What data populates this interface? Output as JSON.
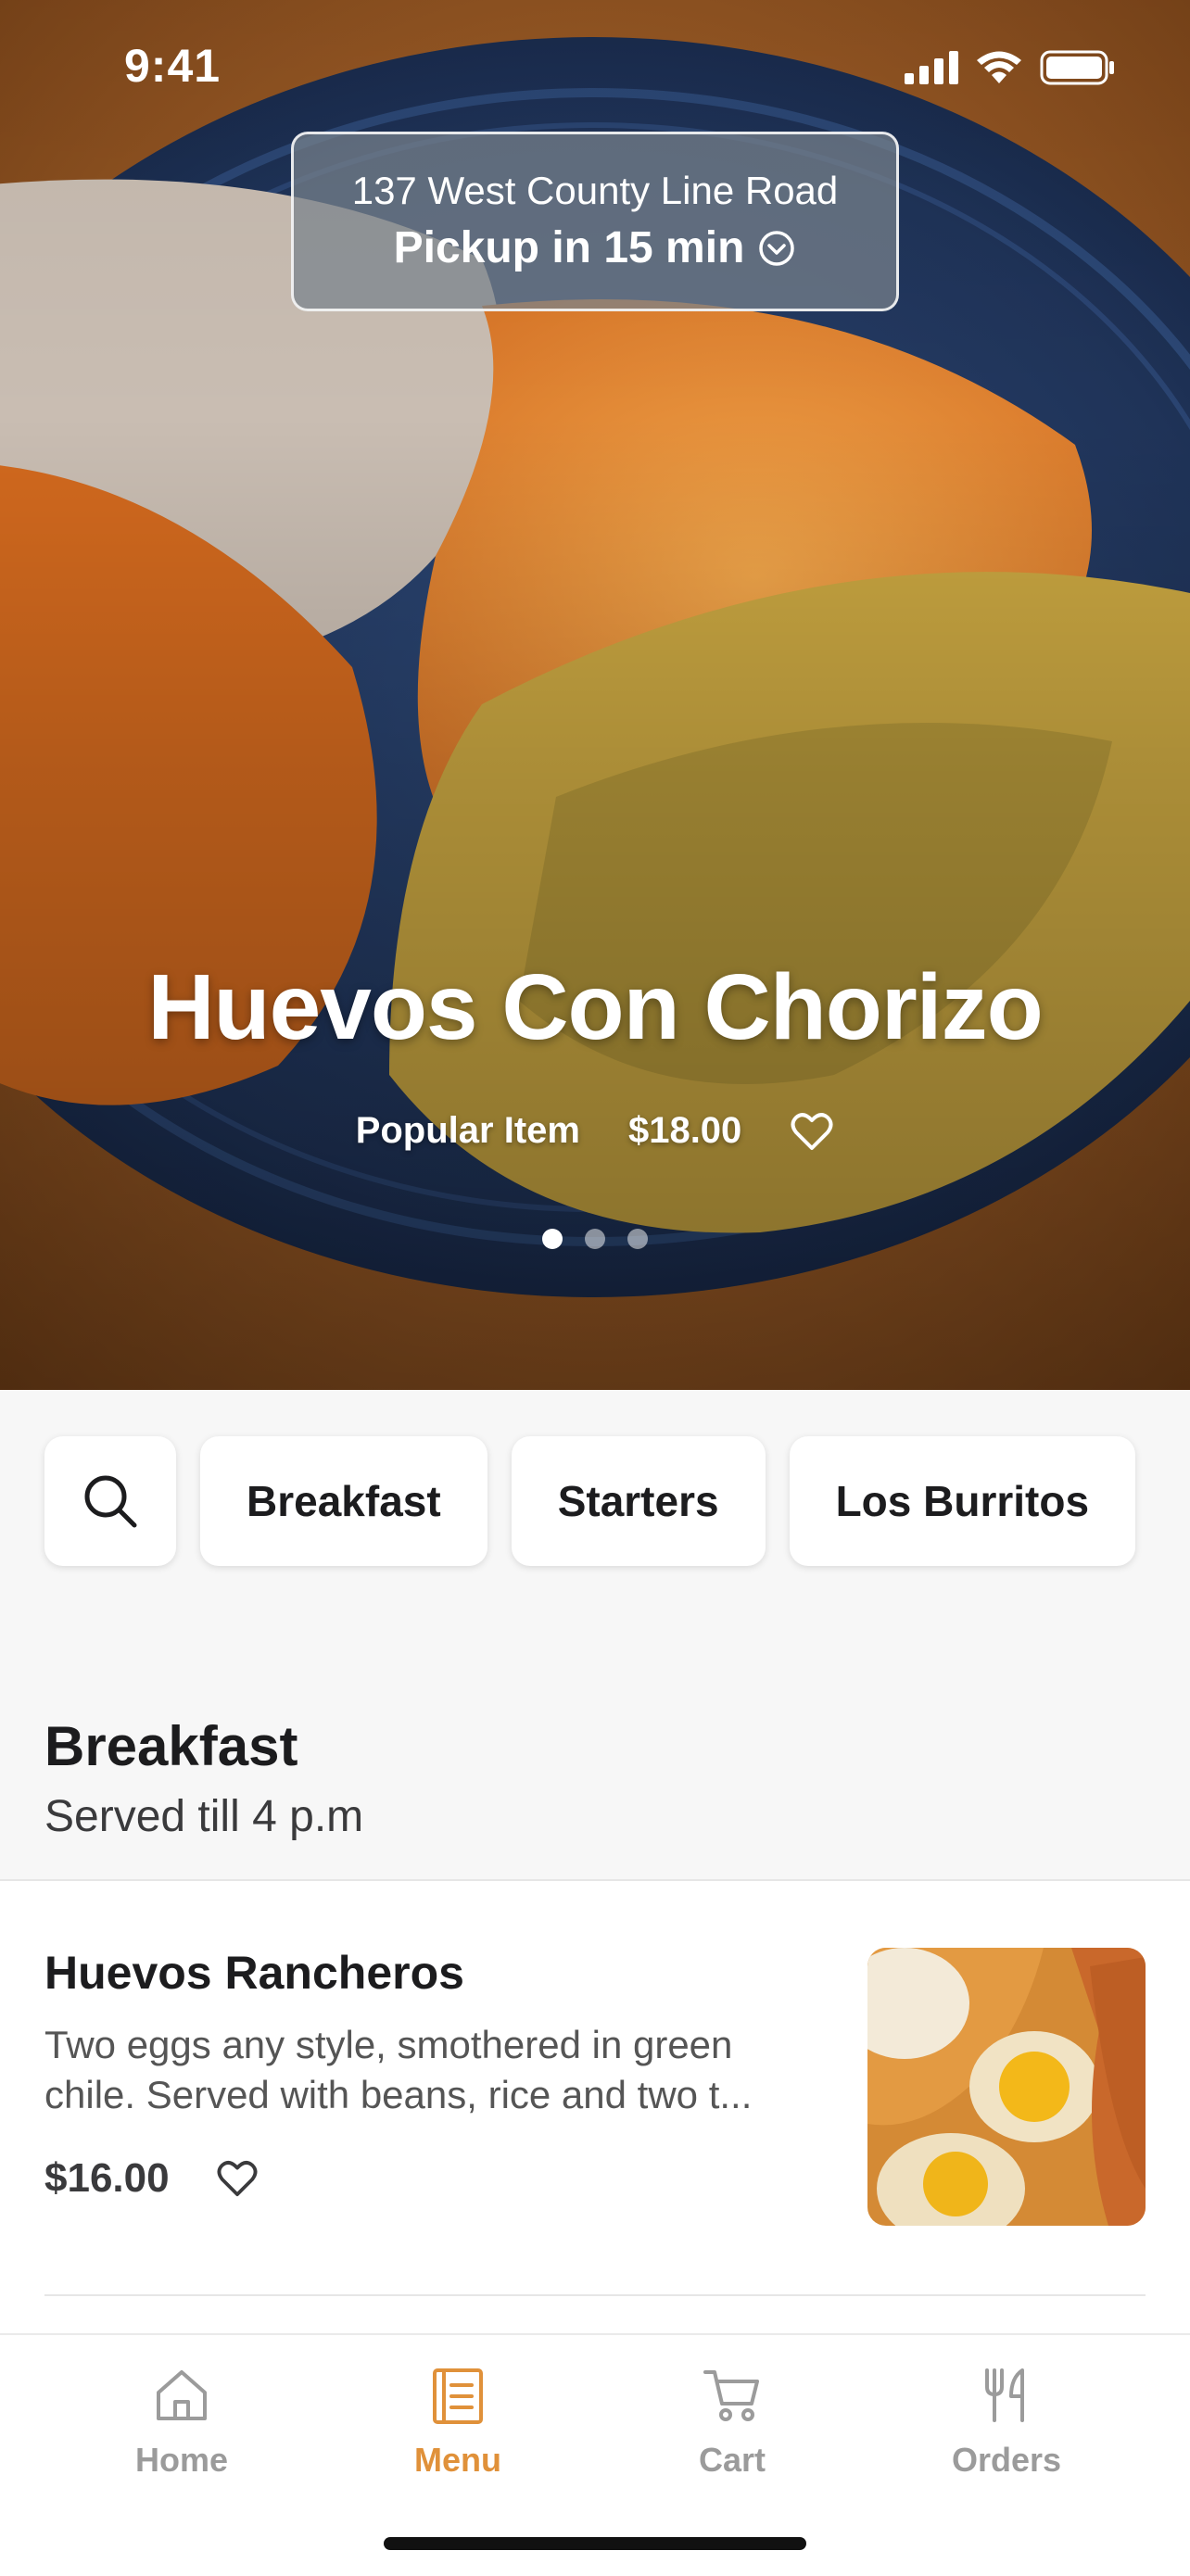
{
  "status_bar": {
    "time": "9:41",
    "icons": [
      "cellular-signal-icon",
      "wifi-icon",
      "battery-icon"
    ]
  },
  "location": {
    "address": "137 West County Line Road",
    "pickup": "Pickup in 15 min",
    "icon": "chevron-down-circle-icon"
  },
  "hero": {
    "title": "Huevos Con Chorizo",
    "tag": "Popular Item",
    "price": "$18.00",
    "favorite_icon": "heart-icon",
    "carousel_dots": 3,
    "active_dot": 1
  },
  "categories": {
    "search_icon": "search-icon",
    "items": [
      "Breakfast",
      "Starters",
      "Los Burritos"
    ]
  },
  "section": {
    "title": "Breakfast",
    "subtitle": "Served till 4 p.m"
  },
  "menu_items": [
    {
      "name": "Huevos Rancheros",
      "desc_line1": "Two eggs any style, smothered in green",
      "desc_line2": "chile. Served with beans, rice and two t...",
      "price": "$16.00",
      "favorite_icon": "heart-icon"
    }
  ],
  "tab_bar": {
    "tabs": [
      {
        "label": "Home",
        "icon": "home-icon"
      },
      {
        "label": "Menu",
        "icon": "menu-book-icon"
      },
      {
        "label": "Cart",
        "icon": "cart-icon"
      },
      {
        "label": "Orders",
        "icon": "fork-knife-icon"
      }
    ],
    "active": "Menu"
  },
  "colors": {
    "accent": "#e0913a",
    "inactive_tab": "#9b9b9b",
    "plate": "#1f3358"
  }
}
